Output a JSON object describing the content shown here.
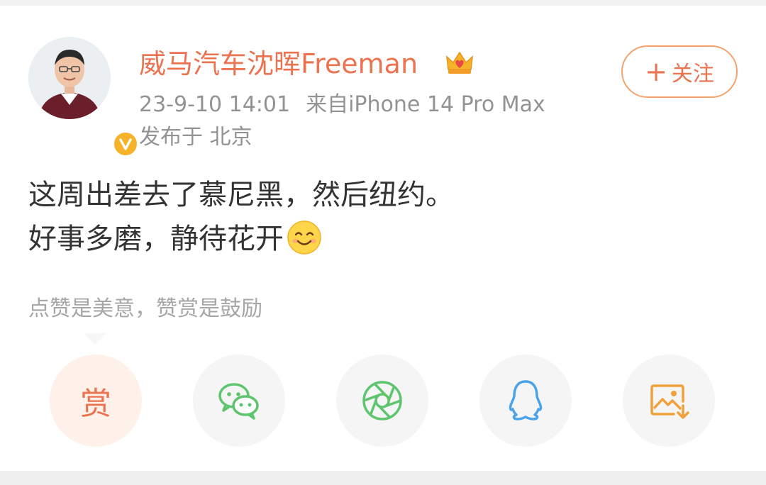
{
  "post": {
    "author": {
      "name": "威马汽车沈晖Freeman",
      "verified_icon": "verified-v-icon",
      "member_icon": "crown-icon"
    },
    "timestamp": "23-9-10 14:01",
    "source": "来自iPhone 14 Pro Max",
    "location": "发布于 北京",
    "follow_label": "关注",
    "text_lines": [
      "这周出差去了慕尼黑，然后纽约。",
      "好事多磨，静待花开"
    ],
    "emoji": "smile-emoji"
  },
  "reward_tip": "点赞是美意，赞赏是鼓励",
  "share_bar": {
    "reward_label": "赏",
    "items": [
      "reward",
      "wechat",
      "moments",
      "qq",
      "save-image"
    ]
  },
  "colors": {
    "accent": "#eb7350",
    "verified": "#f6b32a",
    "wechat": "#5ec56e",
    "moments": "#5ec56e",
    "qq": "#4aa3e8",
    "save": "#f0a13c"
  }
}
